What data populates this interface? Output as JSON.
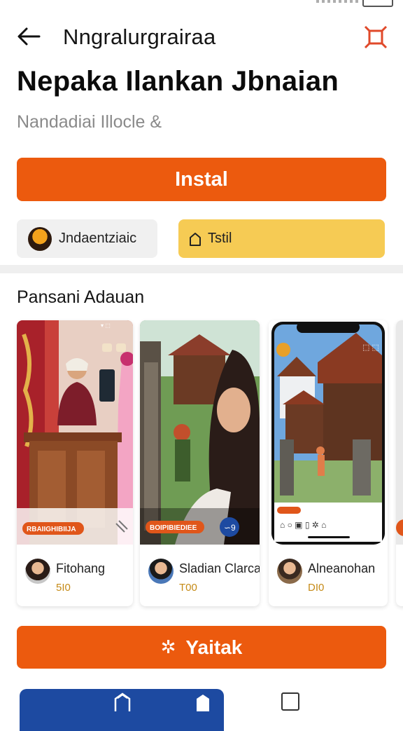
{
  "appbar": {
    "title": "Nngralurgrairaa"
  },
  "app": {
    "name": "Nepaka Ilankan Jbnaian",
    "subtitle": "Nandadiai Illocle &",
    "install_label": "Instal"
  },
  "chips": {
    "developer": "Jndaentziaic",
    "test": "Tstil"
  },
  "section": {
    "title": "Pansani Adauan"
  },
  "cards": [
    {
      "badge": "RBAIIGHIBIIJA",
      "author": "Fitohang",
      "count": "5I0"
    },
    {
      "badge": "BOIPIBIEDIEE",
      "author": "Sladian Clarcan",
      "count": "T00"
    },
    {
      "author": "Alneanohan",
      "count": "DI0"
    }
  ],
  "cta": {
    "label": "Yaitak",
    "glyph": "✲"
  },
  "colors": {
    "accent": "#ec5a0e",
    "chip_yellow": "#f6cb54",
    "nav_blue": "#1d4aa1",
    "count_gold": "#c58a16"
  },
  "icons": [
    "back-arrow-icon",
    "expand-icon",
    "tag-icon",
    "home-icon",
    "bookmark-icon",
    "square-icon"
  ]
}
